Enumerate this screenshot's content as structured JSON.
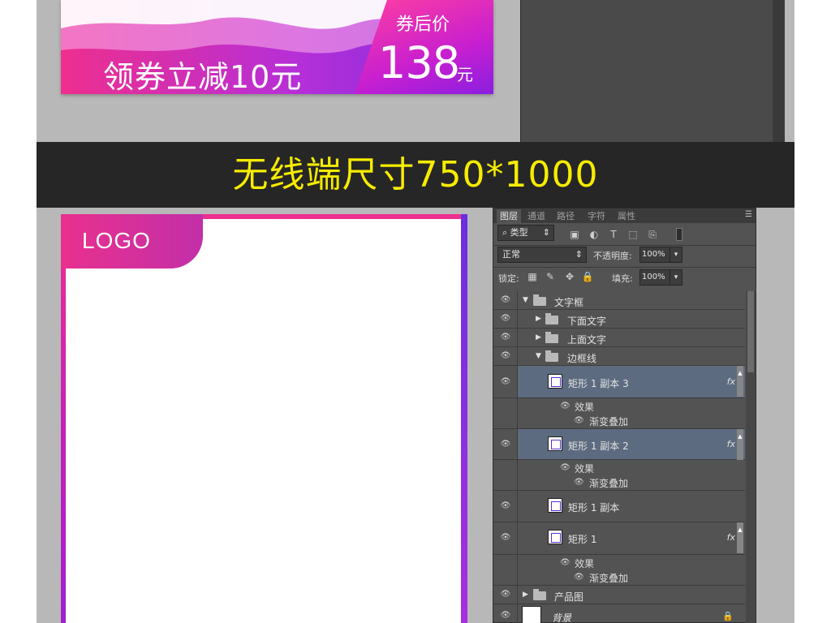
{
  "coupon": {
    "text": "领券立减10元",
    "price_label": "券后价",
    "price_value": "138",
    "price_unit": "元"
  },
  "title_band": {
    "text": "无线端尺寸750*1000"
  },
  "preview": {
    "logo": "LOGO"
  },
  "ps_panel": {
    "tabs": [
      "图层",
      "通道",
      "路径",
      "字符",
      "属性"
    ],
    "active_tab": "图层",
    "filter_type": "类型",
    "blend_mode": "正常",
    "opacity_label": "不透明度:",
    "opacity_value": "100%",
    "lock_label": "锁定:",
    "fill_label": "填充:",
    "fill_value": "100%",
    "layers": {
      "group_text_frame": "文字框",
      "group_bottom_text": "下面文字",
      "group_top_text": "上面文字",
      "group_border": "边框线",
      "rect_copy3": "矩形 1 副本 3",
      "rect_copy2": "矩形 1 副本 2",
      "rect_copy": "矩形 1 副本",
      "rect": "矩形 1",
      "group_product": "产品图",
      "background": "背景",
      "effects": "效果",
      "gradient_overlay": "渐变叠加",
      "fx": "fx"
    }
  },
  "icons": {
    "eye": "eye-icon",
    "folder": "folder-icon",
    "lock": "lock-icon",
    "menu": "panel-menu-icon",
    "search": "search-icon"
  },
  "colors": {
    "title_yellow": "#f6ec00",
    "gradient_pink": "#ee2f8e",
    "gradient_purple": "#7a2fe0",
    "ps_panel_bg": "#535353",
    "ps_selected": "#5c6b7f"
  }
}
